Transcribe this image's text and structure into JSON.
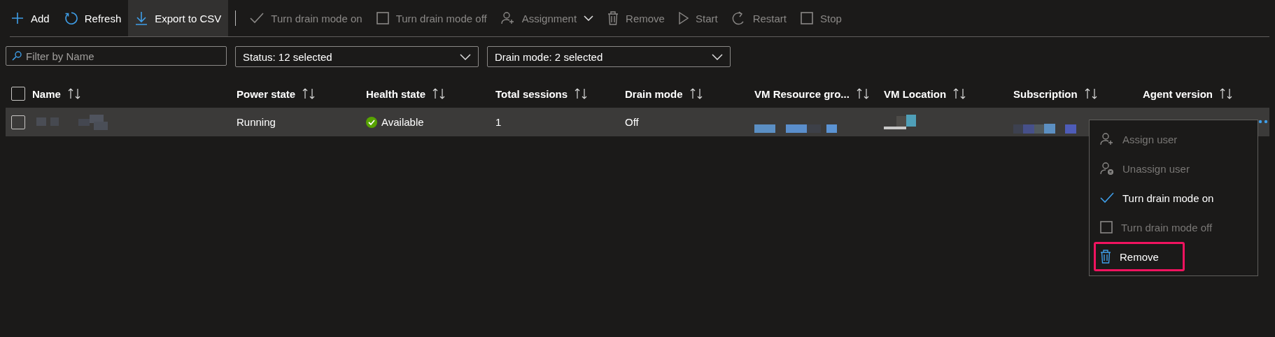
{
  "toolbar": [
    {
      "kind": "plus",
      "label": "Add",
      "disabled": false,
      "selected": false
    },
    {
      "kind": "refresh",
      "label": "Refresh",
      "disabled": false,
      "selected": false
    },
    {
      "kind": "download",
      "label": "Export to CSV",
      "disabled": false,
      "selected": true
    },
    {
      "kind": "separator"
    },
    {
      "kind": "check",
      "label": "Turn drain mode on",
      "disabled": true,
      "selected": false
    },
    {
      "kind": "square",
      "label": "Turn drain mode off",
      "disabled": true,
      "selected": false
    },
    {
      "kind": "person-add",
      "label": "Assignment",
      "disabled": true,
      "selected": false,
      "dropdown": true
    },
    {
      "kind": "trash",
      "label": "Remove",
      "disabled": true,
      "selected": false
    },
    {
      "kind": "play",
      "label": "Start",
      "disabled": true,
      "selected": false
    },
    {
      "kind": "restart",
      "label": "Restart",
      "disabled": true,
      "selected": false
    },
    {
      "kind": "square",
      "label": "Stop",
      "disabled": true,
      "selected": false
    }
  ],
  "filters": {
    "search": {
      "placeholder": "Filter by Name"
    },
    "dropdowns": [
      "Status: 12 selected",
      "Drain mode: 2 selected"
    ]
  },
  "table": {
    "select_all": {
      "checked": false
    },
    "columns": [
      "Name",
      "Power state",
      "Health state",
      "Total sessions",
      "Drain mode",
      "VM Resource gro...",
      "VM Location",
      "Subscription",
      "Agent version"
    ],
    "rows": [
      {
        "checked": false,
        "power_state": "Running",
        "health_state": "Available",
        "healthy": true,
        "total_sessions": "1",
        "drain_mode": "Off"
      }
    ]
  },
  "context_menu": {
    "items": [
      {
        "kind": "person-add",
        "label": "Assign user",
        "disabled": true,
        "highlighted": false
      },
      {
        "kind": "person-remove",
        "label": "Unassign user",
        "disabled": true,
        "highlighted": false
      },
      {
        "kind": "check",
        "label": "Turn drain mode on",
        "disabled": false,
        "highlighted": false
      },
      {
        "kind": "square",
        "label": "Turn drain mode off",
        "disabled": true,
        "highlighted": false
      },
      {
        "kind": "trash",
        "label": "Remove",
        "disabled": false,
        "highlighted": true
      }
    ]
  }
}
